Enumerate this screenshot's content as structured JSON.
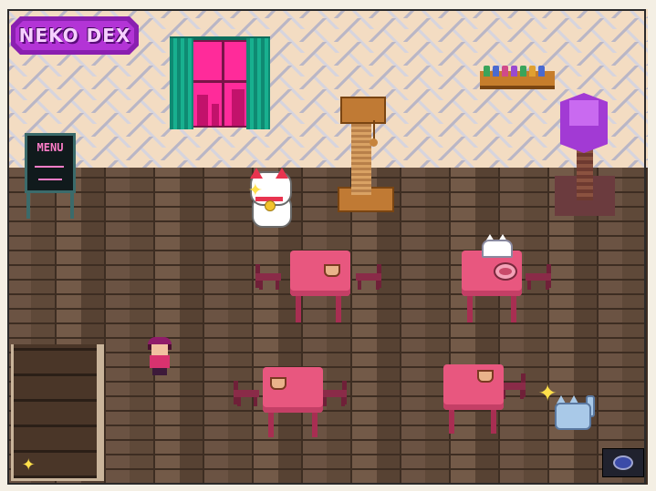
{
  "game": {
    "logo_text": "NEKO DEX",
    "menu_board_text": "MENU"
  },
  "colors": {
    "wall": "#f3dcc2",
    "floor": "#5a4536",
    "logo_purple": "#b334d6",
    "table_pink": "#e8577f",
    "curtain_green": "#18b08f",
    "window_pink": "#ff2b9a",
    "lamp_purple": "#a23ad4"
  },
  "sprites": {
    "player": "player-character",
    "cats": [
      "lucky-cat",
      "white-cat",
      "blue-cat"
    ],
    "hud_icon": "food-bowl-icon"
  }
}
